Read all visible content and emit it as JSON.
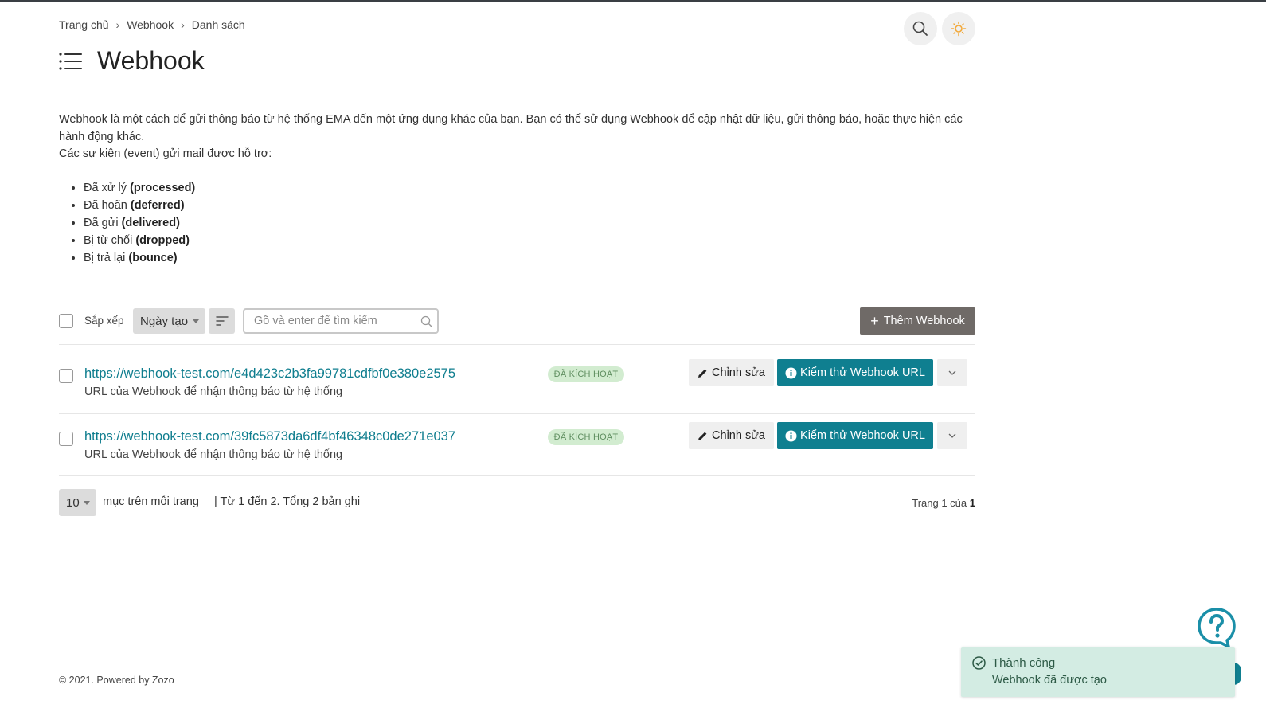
{
  "breadcrumb": {
    "items": [
      "Trang chủ",
      "Webhook",
      "Danh sách"
    ],
    "separator": "›"
  },
  "header": {
    "title": "Webhook",
    "icons": [
      "search-icon",
      "sun-icon"
    ]
  },
  "description": {
    "line1": "Webhook là một cách để gửi thông báo từ hệ thống EMA đến một ứng dụng khác của bạn. Bạn có thể sử dụng Webhook để cập nhật dữ liệu, gửi thông báo, hoặc thực hiện các hành động khác.",
    "line2": "Các sự kiện (event) gửi mail được hỗ trợ:",
    "events": [
      {
        "label": "Đã xử lý",
        "code": "(processed)"
      },
      {
        "label": "Đã hoãn",
        "code": "(deferred)"
      },
      {
        "label": "Đã gửi",
        "code": "(delivered)"
      },
      {
        "label": "Bị từ chối",
        "code": "(dropped)"
      },
      {
        "label": "Bị trả lại",
        "code": "(bounce)"
      }
    ]
  },
  "toolbar": {
    "sort_label": "Sắp xếp",
    "sort_value": "Ngày tạo",
    "search_placeholder": "Gõ và enter để tìm kiếm",
    "add_label": "Thêm Webhook",
    "add_symbol": "+"
  },
  "rows": [
    {
      "url": "https://webhook-test.com/e4d423c2b3fa99781cdfbf0e380e2575",
      "subtitle": "URL của Webhook để nhận thông báo từ hệ thống",
      "status": "ĐÃ KÍCH HOẠT",
      "edit_label": "Chỉnh sửa",
      "test_label": "Kiểm thử Webhook URL"
    },
    {
      "url": "https://webhook-test.com/39fc5873da6df4bf46348c0de271e037",
      "subtitle": "URL của Webhook để nhận thông báo từ hệ thống",
      "status": "ĐÃ KÍCH HOẠT",
      "edit_label": "Chỉnh sửa",
      "test_label": "Kiểm thử Webhook URL"
    }
  ],
  "pagination": {
    "per_page": "10",
    "per_page_label": "mục trên mỗi trang",
    "range": "| Từ 1 đến 2. Tổng 2 bản ghi",
    "page_prefix": "Trang 1 của",
    "total_pages": "1"
  },
  "footer": {
    "text": "© 2021. Powered by Zozo"
  },
  "toast": {
    "title": "Thành công",
    "message": "Webhook đã được tạo"
  },
  "colors": {
    "accent": "#0f7f90",
    "link": "#0e7d8e",
    "add_button": "#6f6a67",
    "badge_bg": "#d2ecd0",
    "toast_bg": "#d3ece3",
    "sun": "#f2a93b"
  }
}
